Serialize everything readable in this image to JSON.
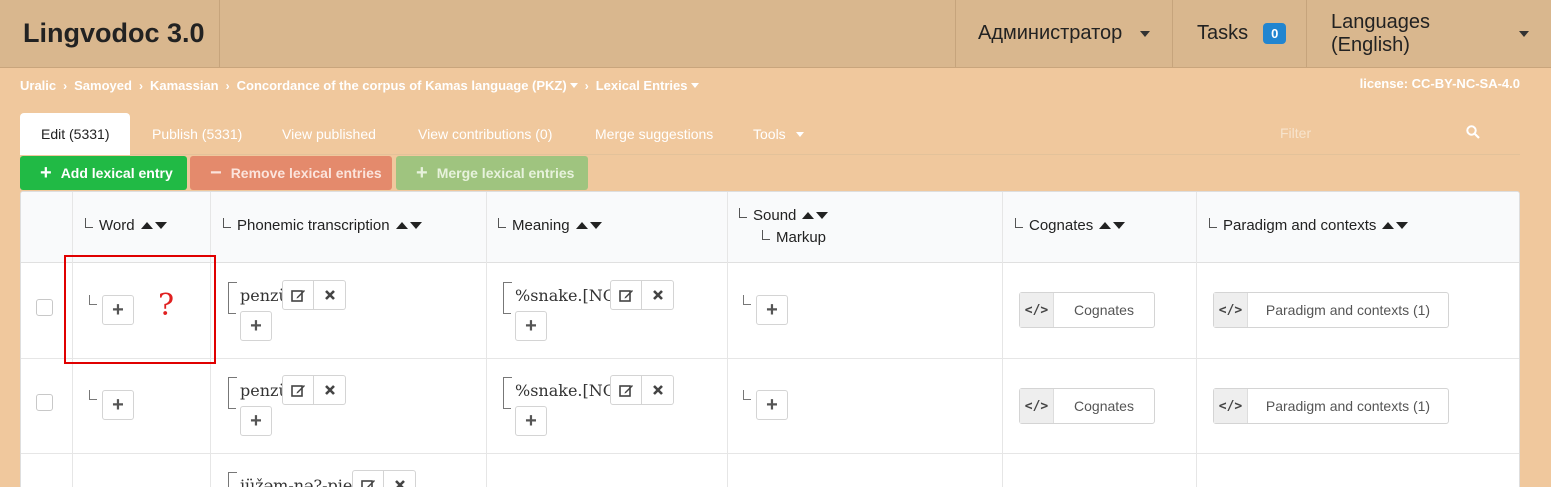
{
  "app": {
    "title": "Lingvodoc 3.0"
  },
  "menu": {
    "user": "Администратор",
    "tasks_label": "Tasks",
    "tasks_count": "0",
    "languages": "Languages (English)"
  },
  "breadcrumb": {
    "items": [
      "Uralic",
      "Samoyed",
      "Kamassian",
      "Concordance of the corpus of Kamas language (PKZ)",
      "Lexical Entries"
    ]
  },
  "license": "license: CC-BY-NC-SA-4.0",
  "tabs": [
    {
      "label": "Edit (5331)"
    },
    {
      "label": "Publish (5331)"
    },
    {
      "label": "View published"
    },
    {
      "label": "View contributions (0)"
    },
    {
      "label": "Merge suggestions"
    },
    {
      "label": "Tools"
    }
  ],
  "filter": {
    "placeholder": "Filter"
  },
  "actions": {
    "add": "Add lexical entry",
    "remove": "Remove lexical entries",
    "merge": "Merge lexical entries"
  },
  "table": {
    "headers": {
      "word": "Word",
      "phonemic": "Phonemic transcription",
      "meaning": "Meaning",
      "sound": "Sound",
      "markup": "Markup",
      "cognates": "Cognates",
      "paradigm": "Paradigm and contexts"
    },
    "rows": [
      {
        "phonemic": "penzü",
        "meaning": "%snake.[NOM",
        "cognates": "Cognates",
        "paradigm": "Paradigm and contexts (1)"
      },
      {
        "phonemic": "penzü",
        "meaning": "%snake.[NOM",
        "cognates": "Cognates",
        "paradigm": "Paradigm and contexts (1)"
      },
      {
        "phonemic": "jüžəm-nə?-pie-m"
      }
    ]
  },
  "annotation": {
    "mark": "?"
  },
  "colors": {
    "accent_blue": "#2185d0",
    "add_green": "#21ba45",
    "highlight_red": "#e00000"
  }
}
